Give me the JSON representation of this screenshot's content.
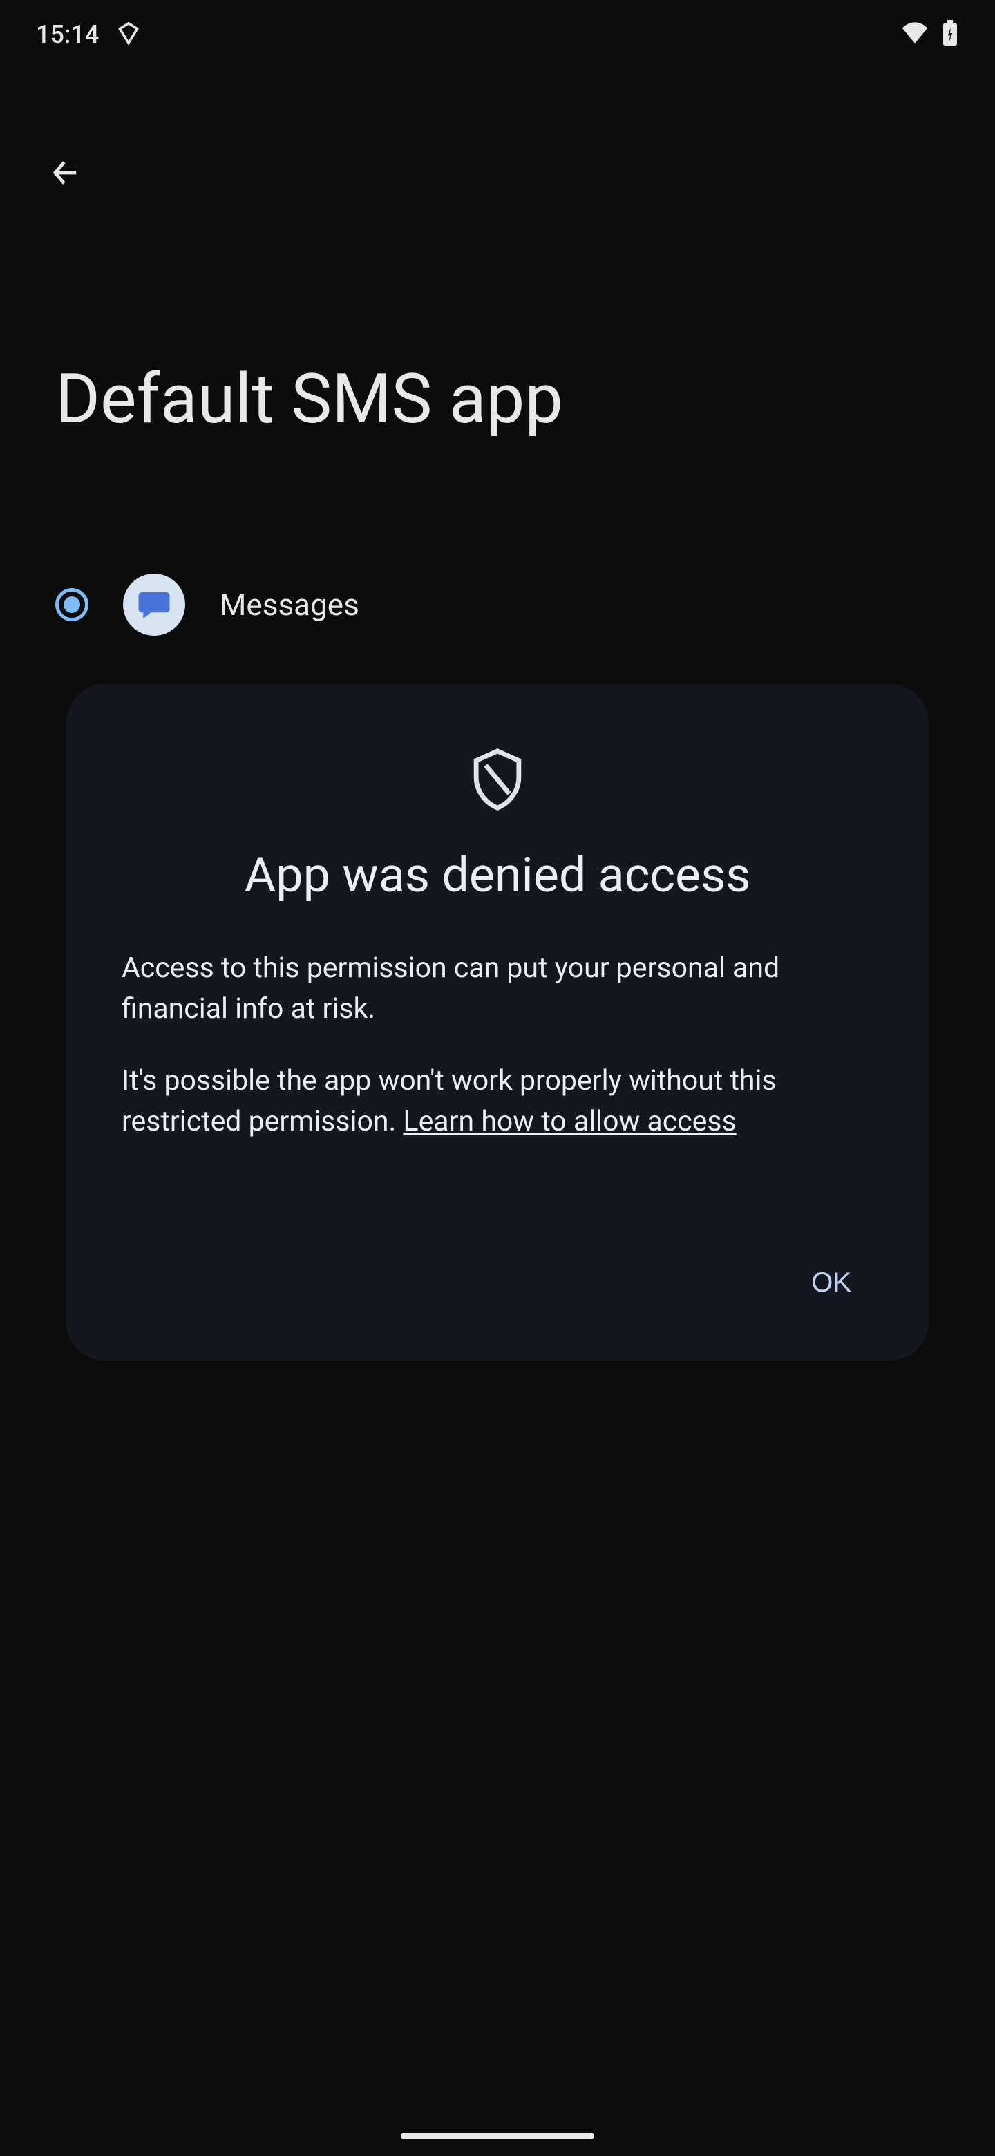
{
  "status_bar": {
    "time": "15:14"
  },
  "page": {
    "title": "Default SMS app"
  },
  "app_list": {
    "selected": {
      "name": "Messages"
    }
  },
  "dialog": {
    "title": "App was denied access",
    "body_1": "Access to this permission can put your personal and financial info at risk.",
    "body_2_prefix": "It's possible the app won't work properly without this restricted permission. ",
    "link_text": "Learn how to allow access",
    "ok_label": "OK"
  }
}
